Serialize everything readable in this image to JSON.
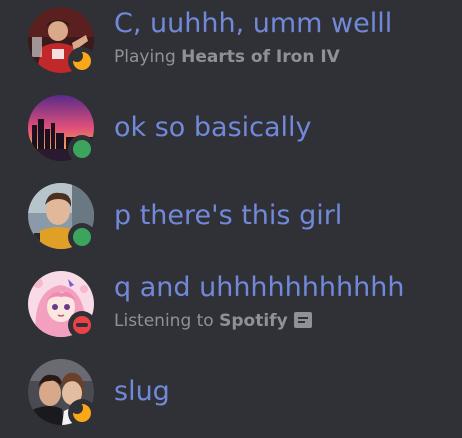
{
  "members": [
    {
      "name": "C, uuhhh, umm welll",
      "status": "idle",
      "activity_prefix": "Playing",
      "activity_name": "Hearts of Iron IV",
      "avatar": "red-jersey-player-avatar"
    },
    {
      "name": "ok so basically",
      "status": "online",
      "activity_prefix": "",
      "activity_name": "",
      "avatar": "city-sunset-avatar"
    },
    {
      "name": "p there's this girl",
      "status": "online",
      "activity_prefix": "",
      "activity_name": "",
      "avatar": "young-man-photo-avatar"
    },
    {
      "name": "q and uhhhhhhhhhhh",
      "status": "dnd",
      "activity_prefix": "Listening to",
      "activity_name": "Spotify",
      "avatar": "anime-pink-hair-avatar"
    },
    {
      "name": "slug",
      "status": "idle",
      "activity_prefix": "",
      "activity_name": "",
      "avatar": "couple-selfie-avatar"
    }
  ],
  "colors": {
    "background": "#2f3136",
    "name": "#7289da",
    "activity": "#8e9297",
    "online": "#3ba55d",
    "idle": "#faa81a",
    "dnd": "#ed4245"
  }
}
